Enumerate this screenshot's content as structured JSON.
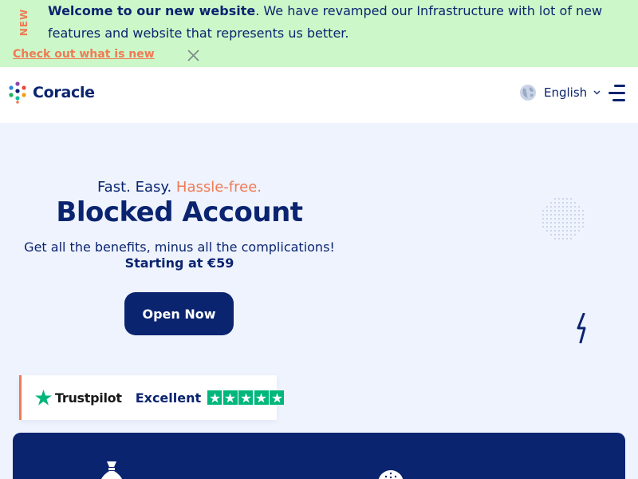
{
  "banner": {
    "tag": "NEW",
    "headline": "Welcome to our new website",
    "message": ". We have revamped our Infrastructure with lot of new features and website that represents us better.",
    "link": "Check out what is new",
    "close_icon": "close-icon"
  },
  "header": {
    "brand": "Coracle",
    "logo_icon": "coracle-dots-logo",
    "language": "English",
    "globe_icon": "globe-icon",
    "chevron_icon": "chevron-down-icon",
    "menu_icon": "hamburger-menu-icon"
  },
  "hero": {
    "tagline_part1": "Fast. Easy. ",
    "tagline_accent": "Hassle-free.",
    "title": "Blocked Account",
    "subtitle": "Get all the benefits, minus all the complications!",
    "price": "Starting at €59",
    "cta": "Open Now"
  },
  "trustpilot": {
    "brand": "Trustpilot",
    "rating": "Excellent",
    "stars": 5,
    "star_icon": "star-icon"
  },
  "features": {
    "icons": [
      "money-bag-euro-icon",
      "clock-icon",
      "calendar-icon",
      "globe-icon"
    ]
  },
  "colors": {
    "navy": "#0b2470",
    "accent": "#f07a55",
    "banner_bg": "#ccf7c8",
    "hero_bg": "#eef3fd",
    "trustpilot_green": "#00b67a"
  }
}
